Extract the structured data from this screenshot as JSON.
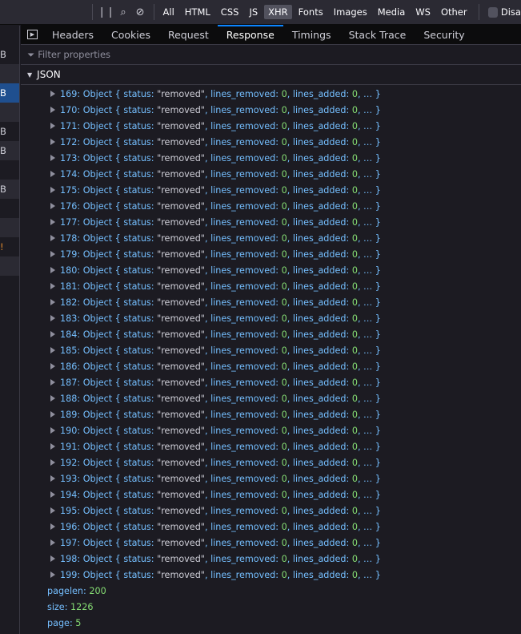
{
  "toolbar": {
    "filters": [
      "All",
      "HTML",
      "CSS",
      "JS",
      "XHR",
      "Fonts",
      "Images",
      "Media",
      "WS",
      "Other"
    ],
    "active_filter": "XHR",
    "disable_cache_label": "Disa"
  },
  "tabs": [
    "Headers",
    "Cookies",
    "Request",
    "Response",
    "Timings",
    "Stack Trace",
    "Security"
  ],
  "active_tab": "Response",
  "filter_placeholder": "Filter properties",
  "json_label": "JSON",
  "left_rows": [
    "B",
    "",
    "B",
    "",
    "B",
    "B",
    "",
    "B",
    "",
    "",
    "!",
    "",
    ""
  ],
  "items": {
    "start": 169,
    "end": 199,
    "type": "Object",
    "status": "\"removed\"",
    "lines_removed": "0",
    "lines_added": "0"
  },
  "props": [
    {
      "key": "pagelen",
      "value": "200"
    },
    {
      "key": "size",
      "value": "1226"
    },
    {
      "key": "page",
      "value": "5"
    }
  ]
}
